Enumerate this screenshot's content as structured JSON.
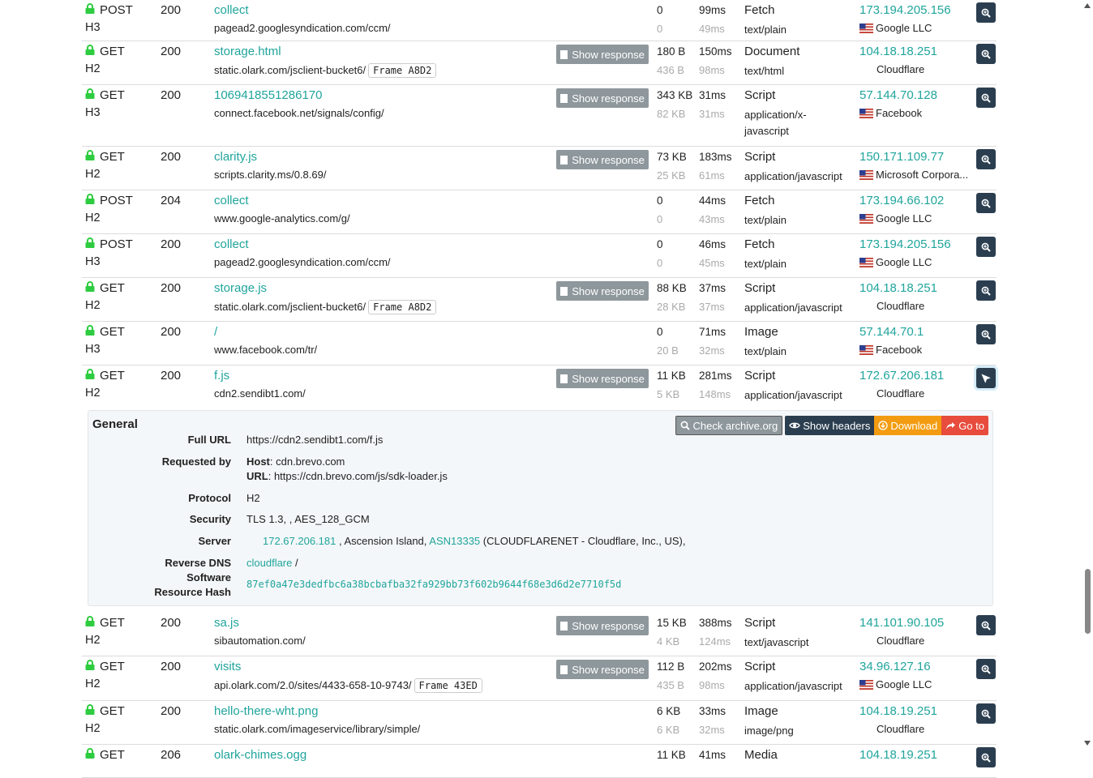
{
  "show_response_label": "Show response",
  "requests": [
    {
      "method": "POST",
      "protocol": "H3",
      "status": "200",
      "name": "collect",
      "path": "pagead2.googlesyndication.com/ccm/",
      "frame": "",
      "show_response": false,
      "size": "0",
      "transfer": "0",
      "time": "99ms",
      "latency": "49ms",
      "type": "Fetch",
      "mime": "text/plain",
      "ip": "173.194.205.156",
      "org": "Google LLC",
      "flag": "us"
    },
    {
      "method": "GET",
      "protocol": "H2",
      "status": "200",
      "name": "storage.html",
      "path": "static.olark.com/jsclient-bucket6/",
      "frame": "Frame A8D2",
      "show_response": true,
      "size": "180 B",
      "transfer": "436 B",
      "time": "150ms",
      "latency": "98ms",
      "type": "Document",
      "mime": "text/html",
      "ip": "104.18.18.251",
      "org": "Cloudflare",
      "flag": ""
    },
    {
      "method": "GET",
      "protocol": "H3",
      "status": "200",
      "name": "1069418551286170",
      "path": "connect.facebook.net/signals/config/",
      "frame": "",
      "show_response": true,
      "size": "343 KB",
      "transfer": "82 KB",
      "time": "31ms",
      "latency": "31ms",
      "type": "Script",
      "mime": "application/x-javascript",
      "ip": "57.144.70.128",
      "org": "Facebook",
      "flag": "us"
    },
    {
      "method": "GET",
      "protocol": "H2",
      "status": "200",
      "name": "clarity.js",
      "path": "scripts.clarity.ms/0.8.69/",
      "frame": "",
      "show_response": true,
      "size": "73 KB",
      "transfer": "25 KB",
      "time": "183ms",
      "latency": "61ms",
      "type": "Script",
      "mime": "application/javascript",
      "ip": "150.171.109.77",
      "org": "Microsoft Corpora...",
      "flag": "us"
    },
    {
      "method": "POST",
      "protocol": "H2",
      "status": "204",
      "name": "collect",
      "path": "www.google-analytics.com/g/",
      "frame": "",
      "show_response": false,
      "size": "0",
      "transfer": "0",
      "time": "44ms",
      "latency": "43ms",
      "type": "Fetch",
      "mime": "text/plain",
      "ip": "173.194.66.102",
      "org": "Google LLC",
      "flag": "us"
    },
    {
      "method": "POST",
      "protocol": "H3",
      "status": "200",
      "name": "collect",
      "path": "pagead2.googlesyndication.com/ccm/",
      "frame": "",
      "show_response": false,
      "size": "0",
      "transfer": "0",
      "time": "46ms",
      "latency": "45ms",
      "type": "Fetch",
      "mime": "text/plain",
      "ip": "173.194.205.156",
      "org": "Google LLC",
      "flag": "us"
    },
    {
      "method": "GET",
      "protocol": "H2",
      "status": "200",
      "name": "storage.js",
      "path": "static.olark.com/jsclient-bucket6/",
      "frame": "Frame A8D2",
      "show_response": true,
      "size": "88 KB",
      "transfer": "28 KB",
      "time": "37ms",
      "latency": "37ms",
      "type": "Script",
      "mime": "application/javascript",
      "ip": "104.18.18.251",
      "org": "Cloudflare",
      "flag": ""
    },
    {
      "method": "GET",
      "protocol": "H3",
      "status": "200",
      "name": "/",
      "path": "www.facebook.com/tr/",
      "frame": "",
      "show_response": false,
      "size": "0",
      "transfer": "20 B",
      "time": "71ms",
      "latency": "32ms",
      "type": "Image",
      "mime": "text/plain",
      "ip": "57.144.70.1",
      "org": "Facebook",
      "flag": "us"
    },
    {
      "method": "GET",
      "protocol": "H2",
      "status": "200",
      "name": "f.js",
      "path": "cdn2.sendibt1.com/",
      "frame": "",
      "show_response": true,
      "size": "11 KB",
      "transfer": "5 KB",
      "time": "281ms",
      "latency": "148ms",
      "type": "Script",
      "mime": "application/javascript",
      "ip": "172.67.206.181",
      "org": "Cloudflare",
      "flag": ""
    },
    {
      "method": "GET",
      "protocol": "H2",
      "status": "200",
      "name": "sa.js",
      "path": "sibautomation.com/",
      "frame": "",
      "show_response": true,
      "size": "15 KB",
      "transfer": "4 KB",
      "time": "388ms",
      "latency": "124ms",
      "type": "Script",
      "mime": "text/javascript",
      "ip": "141.101.90.105",
      "org": "Cloudflare",
      "flag": ""
    },
    {
      "method": "GET",
      "protocol": "H2",
      "status": "200",
      "name": "visits",
      "path": "api.olark.com/2.0/sites/4433-658-10-9743/",
      "frame": "Frame 43ED",
      "show_response": true,
      "size": "112 B",
      "transfer": "435 B",
      "time": "202ms",
      "latency": "98ms",
      "type": "Script",
      "mime": "application/javascript",
      "ip": "34.96.127.16",
      "org": "Google LLC",
      "flag": "us"
    },
    {
      "method": "GET",
      "protocol": "H2",
      "status": "200",
      "name": "hello-there-wht.png",
      "path": "static.olark.com/imageservice/library/simple/",
      "frame": "",
      "show_response": false,
      "size": "6 KB",
      "transfer": "6 KB",
      "time": "33ms",
      "latency": "32ms",
      "type": "Image",
      "mime": "image/png",
      "ip": "104.18.19.251",
      "org": "Cloudflare",
      "flag": ""
    },
    {
      "method": "GET",
      "protocol": "",
      "status": "206",
      "name": "olark-chimes.ogg",
      "path": "",
      "frame": "",
      "show_response": false,
      "size": "11 KB",
      "transfer": "",
      "time": "41ms",
      "latency": "",
      "type": "Media",
      "mime": "",
      "ip": "104.18.19.251",
      "org": "",
      "flag": ""
    }
  ],
  "detail": {
    "title": "General",
    "buttons": {
      "archive": "Check archive.org",
      "headers": "Show headers",
      "download": "Download",
      "goto": "Go to"
    },
    "full_url_label": "Full URL",
    "full_url": "https://cdn2.sendibt1.com/f.js",
    "requested_by_label": "Requested by",
    "host_key": "Host",
    "host_value": ": cdn.brevo.com",
    "url_key": "URL",
    "url_value": ": https://cdn.brevo.com/js/sdk-loader.js",
    "protocol_label": "Protocol",
    "protocol": "H2",
    "security_label": "Security",
    "security": "TLS 1.3, , AES_128_GCM",
    "server_label": "Server",
    "server_ip": "172.67.206.181",
    "server_location": " , Ascension Island, ",
    "server_asn": "ASN13335",
    "server_asn_desc": " (CLOUDFLARENET - Cloudflare, Inc., US),",
    "reverse_dns_label": "Reverse DNS",
    "reverse_dns": "cloudflare",
    "reverse_dns_suffix": " /",
    "software_label": "Software",
    "hash_label": "Resource Hash",
    "hash": "87ef0a47e3dedfbc6a38bcbafba32fa929bb73f602b9644f68e3d6d2e7710f5d"
  }
}
